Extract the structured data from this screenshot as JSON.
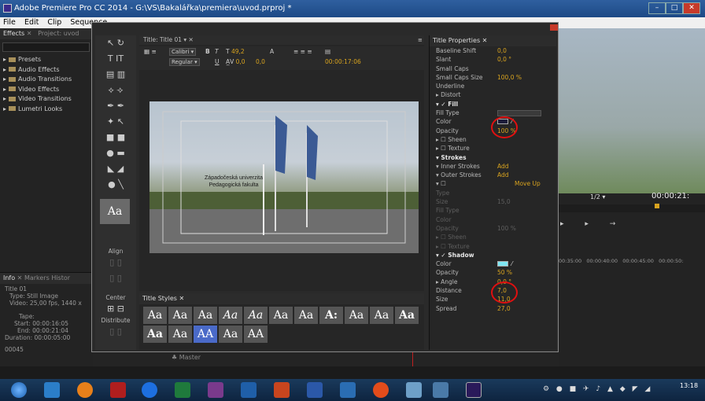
{
  "window": {
    "title": "Adobe Premiere Pro CC 2014 - G:\\VS\\Bakalářka\\premiera\\uvod.prproj *"
  },
  "menu": [
    "File",
    "Edit",
    "Clip",
    "Sequence"
  ],
  "effects_panel": {
    "tabs": [
      "Effects",
      "Project: uvod"
    ],
    "items": [
      "Presets",
      "Audio Effects",
      "Audio Transitions",
      "Video Effects",
      "Video Transitions",
      "Lumetri Looks"
    ]
  },
  "info_panel": {
    "tabs": [
      "Info",
      "Markers",
      "Histor"
    ],
    "title": "Title 01",
    "type": "Type: Still Image",
    "video": "Video: 25,00 fps, 1440 x",
    "tape": "Tape:",
    "start": "Start: 00:00:16:05",
    "end": "End: 00:00:21:04",
    "duration": "Duration: 00:00:05:00",
    "frame": "00045"
  },
  "titler": {
    "panel_title": "Title: Title 01",
    "font": "Calibri",
    "style": "Regular",
    "size": "49,2",
    "tracking": "0,0",
    "leading": "0,0",
    "timecode": "00:00:17:06",
    "canvas_text": [
      "Západočeská univerzita",
      "Pedagogická fakulta"
    ],
    "align_label": "Align",
    "center_label": "Center",
    "distribute_label": "Distribute",
    "styles_title": "Title Styles",
    "style_swatches": [
      "Aa",
      "Aa",
      "Aa",
      "Aa",
      "Aa",
      "Aa",
      "Aa",
      "A:",
      "Aa",
      "Aa",
      "Aa",
      "Aa",
      "Aa",
      "AA",
      "Aa",
      "AA"
    ]
  },
  "properties": {
    "title": "Title Properties",
    "rows": [
      {
        "label": "Baseline Shift",
        "value": "0,0"
      },
      {
        "label": "Slant",
        "value": "0,0 °"
      },
      {
        "label": "Small Caps",
        "value": ""
      },
      {
        "label": "Small Caps Size",
        "value": "100,0 %"
      },
      {
        "label": "Underline",
        "value": ""
      },
      {
        "label": "▸ Distort",
        "value": ""
      },
      {
        "label": "▾ ✓ Fill",
        "value": "",
        "section": true
      },
      {
        "label": "Fill Type",
        "value": ""
      },
      {
        "label": "Color",
        "value": ""
      },
      {
        "label": "Opacity",
        "value": "100 %"
      },
      {
        "label": "▸ ☐ Sheen",
        "value": ""
      },
      {
        "label": "▸ ☐ Texture",
        "value": ""
      },
      {
        "label": "▾ Strokes",
        "value": "",
        "section": true
      },
      {
        "label": "▾ Inner Strokes",
        "value": "Add"
      },
      {
        "label": "▾ Outer Strokes",
        "value": "Add"
      },
      {
        "label": "▾ ☐",
        "value": "Move Up"
      },
      {
        "label": "Type",
        "value": "",
        "dim": true
      },
      {
        "label": "Size",
        "value": "15,0",
        "dim": true
      },
      {
        "label": "Fill Type",
        "value": "",
        "dim": true
      },
      {
        "label": "Color",
        "value": "",
        "dim": true
      },
      {
        "label": "Opacity",
        "value": "100 %",
        "dim": true
      },
      {
        "label": "▸ ☐ Sheen",
        "value": "",
        "dim": true
      },
      {
        "label": "▸ ☐ Texture",
        "value": "",
        "dim": true
      },
      {
        "label": "▾ ✓ Shadow",
        "value": "",
        "section": true
      },
      {
        "label": "Color",
        "value": ""
      },
      {
        "label": "Opacity",
        "value": "50 %"
      },
      {
        "label": "▸ Angle",
        "value": "0,0 °"
      },
      {
        "label": "Distance",
        "value": "7,0"
      },
      {
        "label": "Size",
        "value": "11,0"
      },
      {
        "label": "Spread",
        "value": "27,0"
      }
    ]
  },
  "right_panel": {
    "timecode": "00:00:21:",
    "zoom": "1/2",
    "ruler": [
      "00:35:00",
      "00:00:40:00",
      "00:00:45:00",
      "00:00:50:"
    ]
  },
  "timeline": {
    "track": "Master"
  },
  "clock": {
    "time": "13:18"
  },
  "colors": {
    "fill_color": "#1c1c3a",
    "shadow_color": "#7ee6f2",
    "accent": "#d8a31f"
  }
}
